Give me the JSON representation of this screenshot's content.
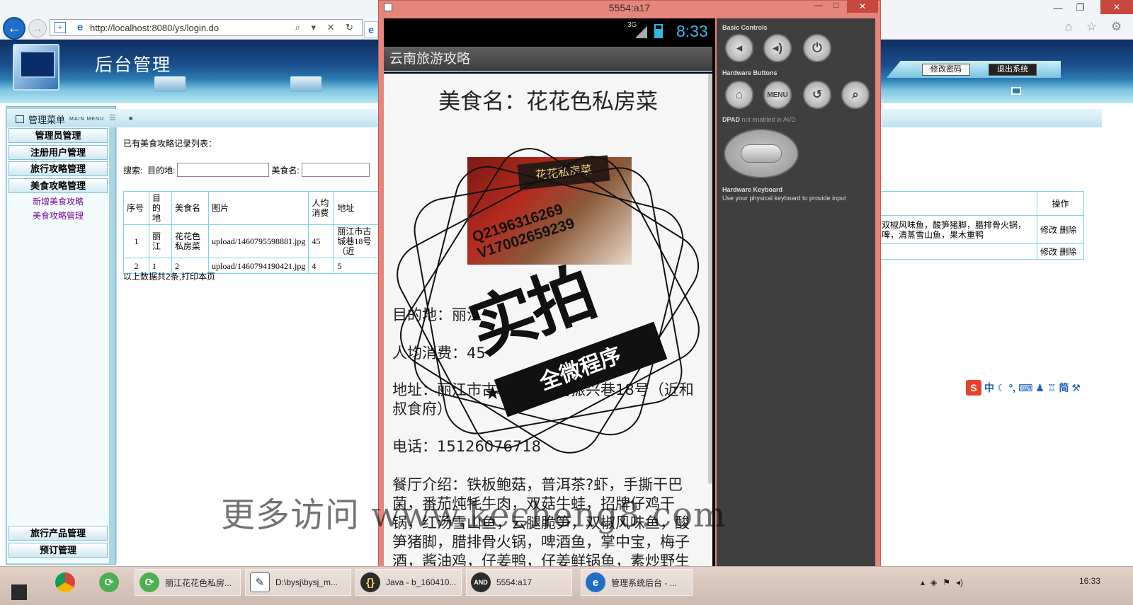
{
  "browser": {
    "url": "http://localhost:8080/ys/login.do",
    "tools": "⌕ ▾ ✕ ↻"
  },
  "admin": {
    "title": "后台管理",
    "change_password": "修改密码",
    "logout": "退出系统",
    "menu_title": "管理菜单",
    "menu_title_en": "MAIN MENU",
    "menu_buttons": [
      "管理员管理",
      "注册用户管理",
      "旅行攻略管理",
      "美食攻略管理"
    ],
    "menu_links": [
      "新增美食攻略",
      "美食攻略管理"
    ],
    "menu_bottom_buttons": [
      "旅行产品管理",
      "预订管理"
    ]
  },
  "content": {
    "records_title": "已有美食攻略记录列表：",
    "search_label": "搜索:",
    "destination_label": "目的地:",
    "food_name_label": "美食名:",
    "table_headers": [
      "序号",
      "目的地",
      "美食名",
      "图片",
      "人均消费",
      "地址"
    ],
    "rows": [
      [
        "1",
        "丽江",
        "花花色私房菜",
        "upload/1460795598881.jpg",
        "45",
        "丽江市古城巷18号（近"
      ],
      [
        "2",
        "1",
        "2",
        "upload/1460794190421.jpg",
        "4",
        "5"
      ]
    ],
    "right_header": "操作",
    "right_rows": [
      {
        "text": "双椒风味鱼，酸笋猪脚，腊排骨火锅，啤，清蒸雪山鱼，果木重鸭",
        "actions": "修改 删除"
      },
      {
        "text": "",
        "actions": "修改 删除"
      }
    ],
    "footnote": "以上数据共2条,打印本页"
  },
  "emulator": {
    "title": "5554:a17",
    "status_network": "3G",
    "time": "8:33",
    "app_title": "云南旅游攻略",
    "food_name": "美食名：花花色私房菜",
    "image_sign": "花花私房菜",
    "destination": "目的地：丽江",
    "avg_cost": "人均消费：45",
    "address": "地址：丽江市古城区七一街振兴巷18号（近和叔食府）",
    "phone": "电话：15126076718",
    "intro": "餐厅介绍：铁板鲍菇，普洱茶?虾，手撕干巴菌，番茄炖牦牛肉，双菇牛蛙，招牌仔鸡干锅，红汤雪山鱼，云腿脆笋，双椒风味鱼，酸笋猪脚，腊排骨火锅，啤酒鱼，掌中宝，梅子酒，酱油鸡，仔姜鸭，仔姜鲜锅鱼，素炒野生",
    "controls": {
      "basic": "Basic Controls",
      "hardware": "Hardware Buttons",
      "dpad": "DPAD",
      "dpad_note": "not enabled in AVD",
      "keyboard": "Hardware Keyboard",
      "keyboard_note": "Use your physical keyboard to provide input",
      "menu": "MENU"
    }
  },
  "stamp": {
    "line1": "Q2196316269",
    "line2": "V17002659239",
    "main": "实拍",
    "band": "全微程序"
  },
  "watermark": "更多访问 www.kecheng8.com",
  "sogou": [
    "中",
    "简"
  ],
  "taskbar": {
    "items": [
      "丽江花花色私房...",
      "D:\\bysj\\bysj_m...",
      "Java - b_160410...",
      "5554:a17",
      "管理系统后台 - ..."
    ],
    "clock": "16:33"
  }
}
